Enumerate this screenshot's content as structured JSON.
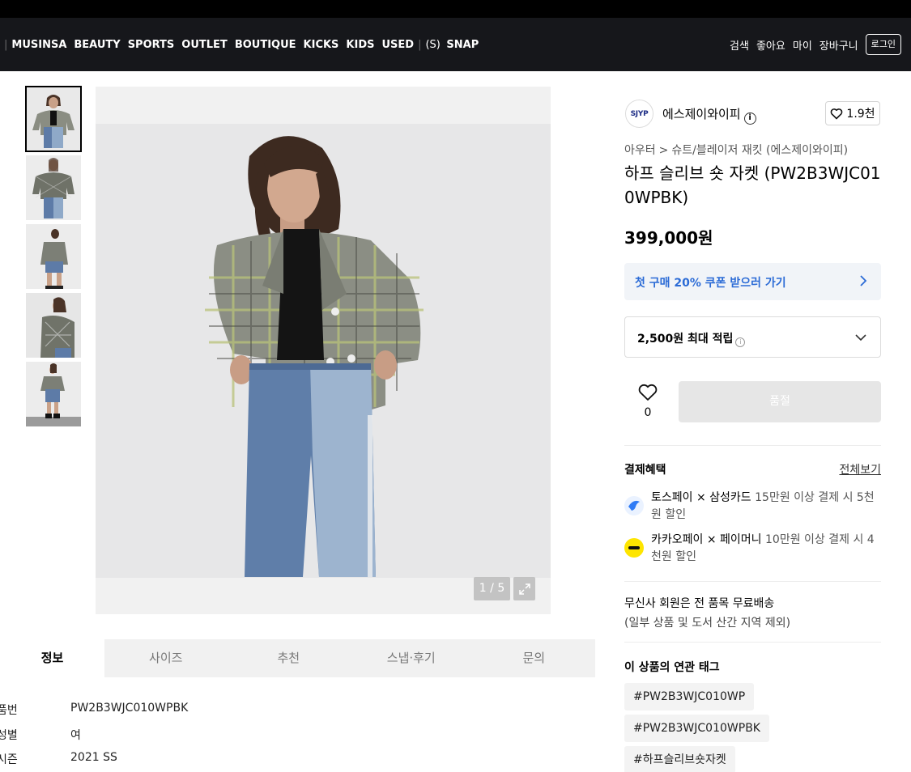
{
  "gnb": {
    "menus": [
      "MUSINSA",
      "BEAUTY",
      "SPORTS",
      "OUTLET",
      "BOUTIQUE",
      "KICKS",
      "KIDS",
      "USED"
    ],
    "snap_mark": "(S)",
    "snap_label": "SNAP",
    "utils": [
      "검색",
      "좋아요",
      "마이",
      "장바구니"
    ],
    "login_label": "로그인"
  },
  "gallery": {
    "thumb_count": 5,
    "active_index": 0,
    "page_current": "1",
    "page_total": "5",
    "page_sep": "/"
  },
  "tabs": [
    "정보",
    "사이즈",
    "추천",
    "스냅·후기",
    "문의"
  ],
  "specs": [
    {
      "label": "품번",
      "value": "PW2B3WJC010WPBK"
    },
    {
      "label": "성별",
      "value": "여"
    },
    {
      "label": "시즌",
      "value": "2021 SS"
    }
  ],
  "brand": {
    "logo_text": "SJYP",
    "name": "에스제이와이피",
    "info_icon": "i",
    "likes": "1.9천"
  },
  "breadcrumb": {
    "level1": "아우터",
    "sep": ">",
    "level2": "슈트/블레이저 재킷 (에스제이와이피)"
  },
  "product": {
    "title": "하프 슬리브 숏 자켓 (PW2B3WJC010WPBK)",
    "price": "399,000원"
  },
  "coupon": {
    "label": "첫 구매 20% 쿠폰 받으러 가기"
  },
  "points": {
    "label": "2,500원 최대 적립",
    "info_icon": "i"
  },
  "wish": {
    "count": "0"
  },
  "buy": {
    "label": "품절"
  },
  "benefits": {
    "title": "결제혜택",
    "view_all": "전체보기",
    "items": [
      {
        "name": "토스페이 × 삼성카드",
        "desc": "15만원 이상 결제 시 5천원 할인"
      },
      {
        "name": "카카오페이 × 페이머니",
        "desc": "10만원 이상 결제 시 4천원 할인"
      }
    ]
  },
  "shipping": {
    "line1": "무신사 회원은 전 품목 무료배송",
    "line2": "(일부 상품 및 도서 산간 지역 제외)"
  },
  "related_tags": {
    "title": "이 상품의 연관 태그",
    "tags": [
      "#PW2B3WJC010WP",
      "#PW2B3WJC010WPBK",
      "#하프슬리브숏자켓"
    ]
  },
  "colors": {
    "gnb_bg": "#16171b",
    "coupon_text": "#2b6bd6",
    "soldout_bg": "#e6e6e6",
    "toss_blue": "#2f7bf5",
    "kakao_yellow": "#fee500"
  }
}
